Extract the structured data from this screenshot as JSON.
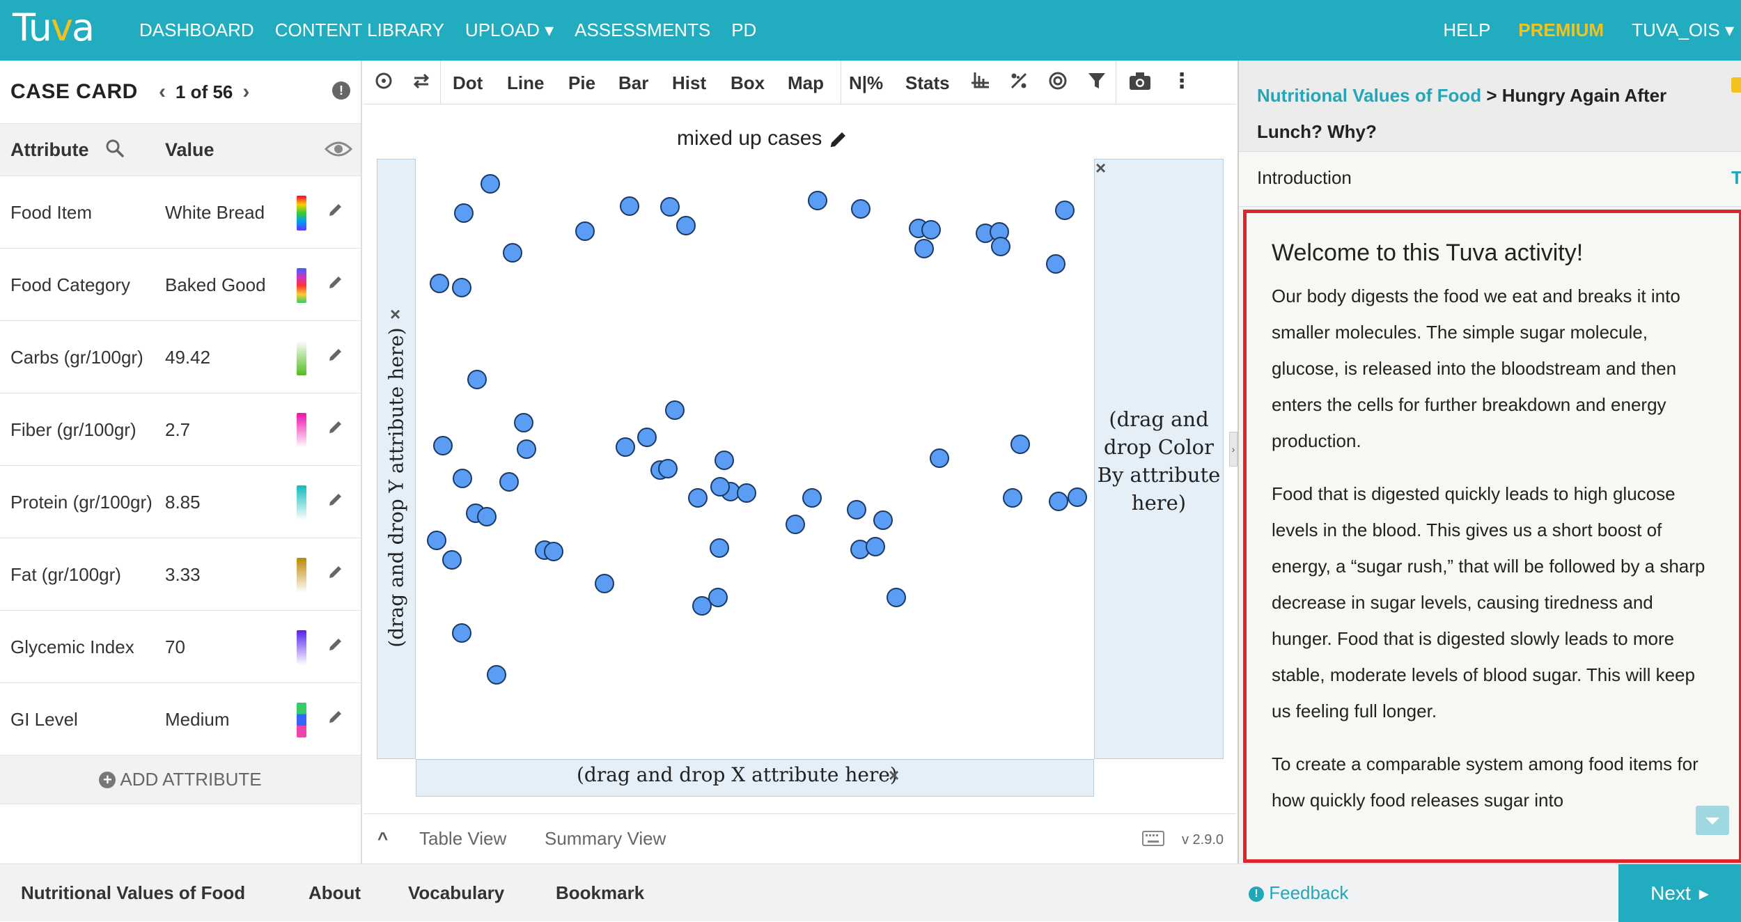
{
  "nav": {
    "logo": "Tuva",
    "links": [
      "DASHBOARD",
      "CONTENT LIBRARY",
      "UPLOAD ▾",
      "ASSESSMENTS",
      "PD"
    ],
    "help": "HELP",
    "premium": "PREMIUM",
    "user": "TUVA_OIS ▾"
  },
  "case_card": {
    "title": "CASE CARD",
    "position": "1 of 56",
    "col_attribute": "Attribute",
    "col_value": "Value",
    "rows": [
      {
        "attr": "Food Item",
        "value": "White Bread"
      },
      {
        "attr": "Food Category",
        "value": "Baked Good"
      },
      {
        "attr": "Carbs (gr/100gr)",
        "value": "49.42"
      },
      {
        "attr": "Fiber (gr/100gr)",
        "value": "2.7"
      },
      {
        "attr": "Protein (gr/100gr)",
        "value": "8.85"
      },
      {
        "attr": "Fat (gr/100gr)",
        "value": "3.33"
      },
      {
        "attr": "Glycemic Index",
        "value": "70"
      },
      {
        "attr": "GI Level",
        "value": "Medium"
      }
    ],
    "add_attribute": "ADD ATTRIBUTE"
  },
  "toolbar": {
    "tools": [
      "Dot",
      "Line",
      "Pie",
      "Bar",
      "Hist",
      "Box",
      "Map",
      "N|%",
      "Stats"
    ]
  },
  "graph": {
    "title": "mixed up cases",
    "y_drop": "(drag and drop Y attribute here)",
    "x_drop": "(drag and drop X attribute here)",
    "color_drop": "(drag and drop Color By attribute here)",
    "point_color": "#5b9cf5"
  },
  "bottom_bar": {
    "table_view": "Table View",
    "summary_view": "Summary View",
    "version": "v 2.9.0"
  },
  "lesson": {
    "dataset_link": "Nutritional Values of Food",
    "separator": " > ",
    "lesson_title": "Hungry Again After Lunch? Why?",
    "section": "Introduction",
    "heading": "Welcome to this Tuva activity!",
    "paragraphs": [
      "Our body digests the food we eat and breaks it into smaller molecules. The simple sugar molecule, glucose, is released into the bloodstream and then enters the cells for further breakdown and energy production.",
      "Food that is digested quickly leads to high glucose levels in the blood. This gives us a short boost of energy, a “sugar rush,” that will be followed by a sharp decrease in sugar levels, causing tiredness and hunger. Food that is digested slowly leads to more stable, moderate levels of blood sugar. This will keep us feeling full longer.",
      "To create a comparable system among food items for how quickly food releases sugar into"
    ]
  },
  "footer": {
    "dataset": "Nutritional Values of Food",
    "about": "About",
    "vocabulary": "Vocabulary",
    "bookmark": "Bookmark",
    "feedback": "Feedback",
    "next": "Next"
  }
}
